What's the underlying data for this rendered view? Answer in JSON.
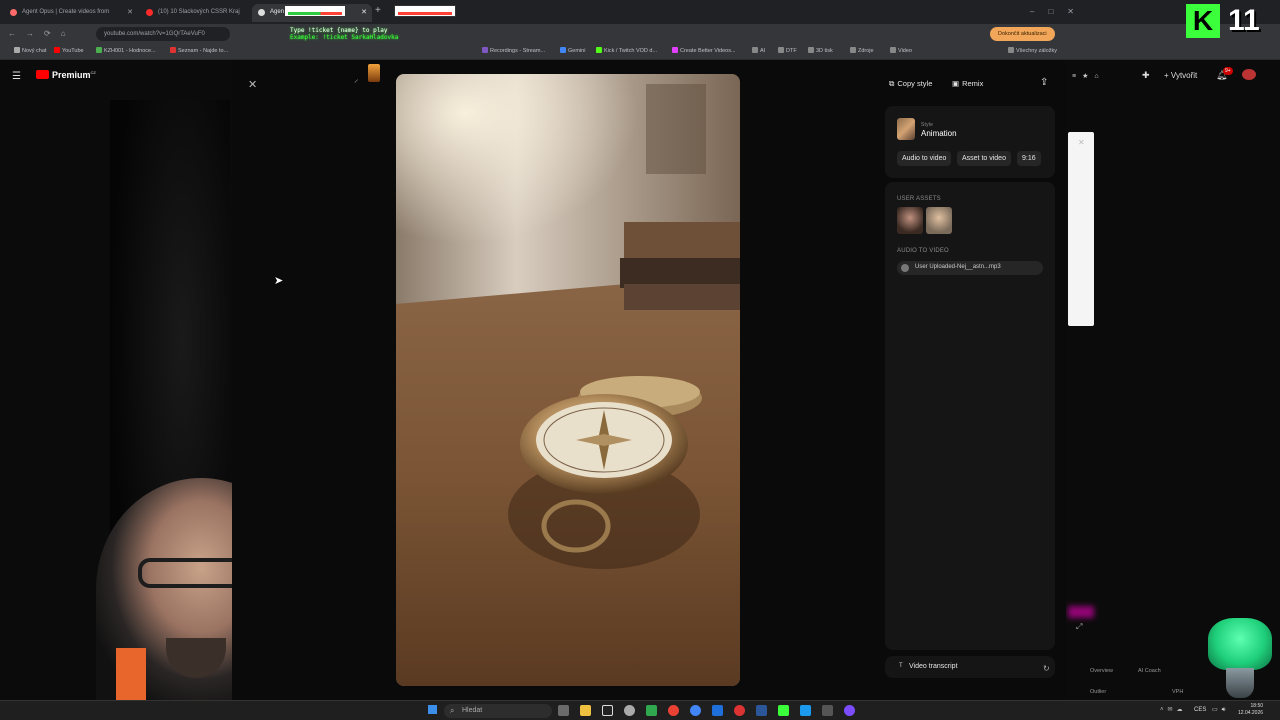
{
  "browser": {
    "tabs": [
      {
        "label": "Agent Opus | Create videos from",
        "color": "#ff6b6b"
      },
      {
        "label": "(10) 10 Slackových CSSR Kraj",
        "color": "#ff2a2a"
      },
      {
        "label": "Agent",
        "color": "#ffffff"
      }
    ],
    "address_url": "youtube.com/watch?v=1GQrTAeVuF0",
    "chrome_pill": "Dokončit aktualizaci",
    "bookmarks": [
      "Nový chat",
      "YouTube",
      "KZH001 - Hodnoce...",
      "Seznam - Najde to...",
      "Recordings - Stream...",
      "Gemini",
      "Kick / Twitch VOD d...",
      "Create Better Videos...",
      "AI",
      "DTF",
      "3D tisk",
      "Zdroje",
      "Video",
      "Všechny záložky"
    ],
    "overlay_lines": [
      "Type !ticket {name} to play",
      "Example: !ticket SarkaHladovka"
    ]
  },
  "youtube": {
    "brand": "Premium",
    "region": "CZ",
    "create_label": "Vytvořit",
    "notif_count": "9+",
    "bottom_tabs": [
      "Overview",
      "AI Coach",
      "Outlier",
      "VPH"
    ]
  },
  "modal": {
    "close_icon": "close-icon",
    "copy_style_label": "Copy style",
    "remix_label": "Remix",
    "style_caption": "Style",
    "style_name": "Animation",
    "audio_to_video_btn": "Audio to video",
    "asset_to_video_btn": "Asset to video",
    "ratio_btn": "9:16",
    "user_assets_label": "USER ASSETS",
    "audio_section_label": "AUDIO TO VIDEO",
    "audio_file": "User Uploaded-Nej__astn...mp3",
    "transcript_label": "Video transcript"
  },
  "overlay": {
    "badge_letter": "K",
    "badge_number": "11"
  },
  "taskbar": {
    "search_placeholder": "Hledat",
    "lang": "CES",
    "time": "18:50",
    "date": "12.04.2026"
  },
  "colors": {
    "yt_red": "#ff0000",
    "badge_green": "#3cff3c",
    "panel_bg": "#151515"
  }
}
